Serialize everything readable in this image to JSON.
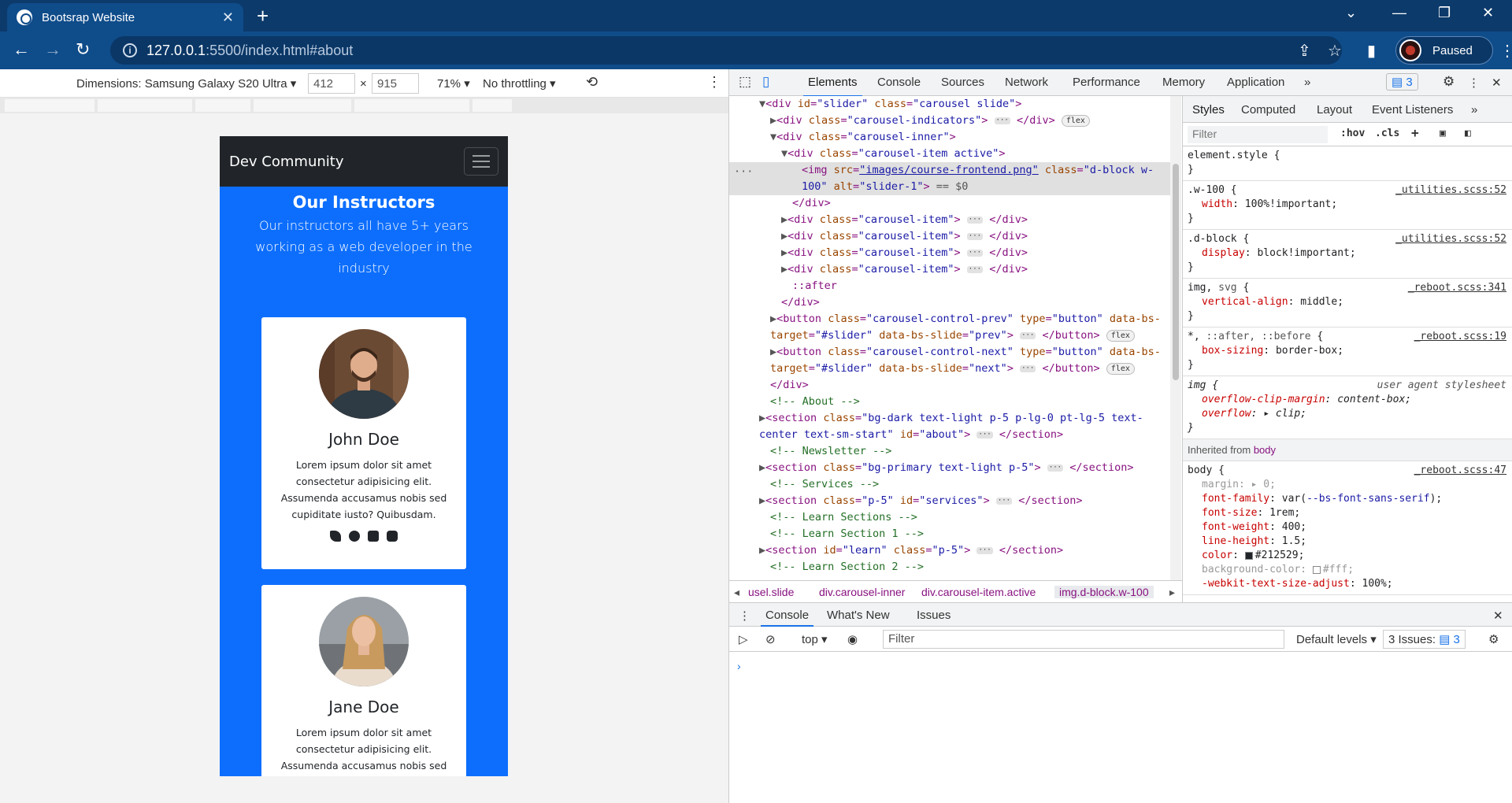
{
  "browser": {
    "tab_title": "Bootsrap Website",
    "url_host": "127.0.0.1",
    "url_path": ":5500/index.html#about",
    "profile_label": "Paused"
  },
  "device_toolbar": {
    "dimensions_label": "Dimensions: Samsung Galaxy S20 Ultra",
    "width": "412",
    "times": "×",
    "height": "915",
    "zoom": "71%",
    "throttling": "No throttling"
  },
  "page": {
    "brand": "Dev Community",
    "section_title": "Our Instructors",
    "section_text": "Our instructors all have 5+ years working as a web developer in the industry",
    "cards": [
      {
        "name": "John Doe",
        "text": "Lorem ipsum dolor sit amet consectetur adipisicing elit. Assumenda accusamus nobis sed cupiditate iusto? Quibusdam."
      },
      {
        "name": "Jane Doe",
        "text": "Lorem ipsum dolor sit amet consectetur adipisicing elit. Assumenda accusamus nobis sed"
      }
    ]
  },
  "devtools": {
    "tabs": [
      "Elements",
      "Console",
      "Sources",
      "Network",
      "Performance",
      "Memory",
      "Application"
    ],
    "issues_count": "3",
    "breadcrumbs": [
      "usel.slide",
      "div.carousel-inner",
      "div.carousel-item.active",
      "img.d-block.w-100"
    ],
    "styles_tabs": [
      "Styles",
      "Computed",
      "Layout",
      "Event Listeners"
    ],
    "styles_filter": "Filter",
    "hov": ":hov",
    "cls": ".cls",
    "inherited_label": "Inherited from",
    "inherited_from": "body"
  },
  "console": {
    "tabs": [
      "Console",
      "What's New",
      "Issues"
    ],
    "context": "top",
    "filter": "Filter",
    "levels": "Default levels",
    "issues_label": "3 Issues:",
    "issues_count": "3"
  }
}
